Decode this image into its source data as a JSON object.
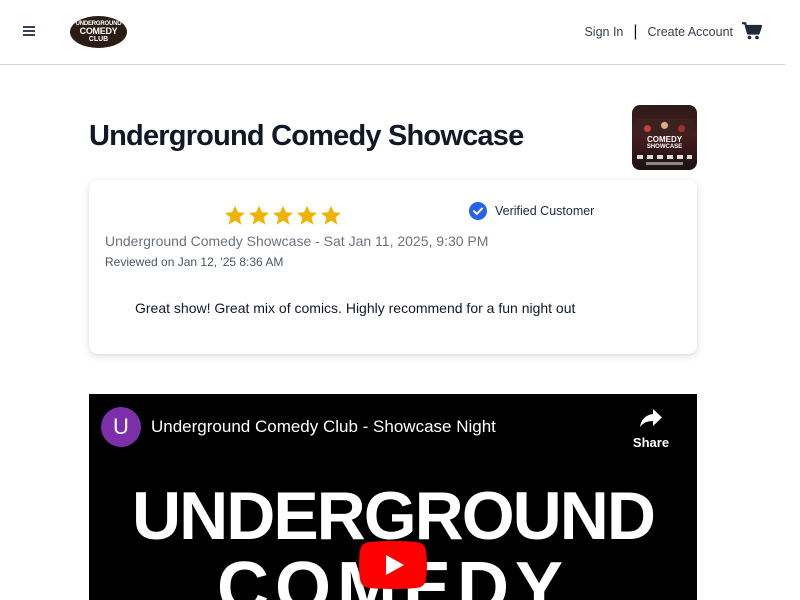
{
  "header": {
    "logo": {
      "line1": "UNDERGROUND",
      "line2": "COMEDY",
      "line3": "CLUB"
    },
    "sign_in": "Sign In",
    "separator": "|",
    "create_account": "Create Account"
  },
  "event": {
    "title": "Underground Comedy Showcase",
    "thumbnail": {
      "line1": "COMEDY",
      "line2": "SHOWCASE"
    }
  },
  "review": {
    "rating": 5,
    "max_rating": 5,
    "verified_label": "Verified Customer",
    "event_line": "Underground Comedy Showcase - Sat Jan 11, 2025, 9:30 PM",
    "reviewed_on": "Reviewed on Jan 12, '25 8:36 AM",
    "text": "Great show! Great mix of comics. Highly recommend for a fun night out"
  },
  "video": {
    "channel_initial": "U",
    "title": "Underground Comedy Club - Showcase Night",
    "share_label": "Share",
    "frame_line1": "UNDERGROUND",
    "frame_line2": "COMEDY"
  },
  "colors": {
    "star": "#f0b400",
    "verified": "#2563eb",
    "avatar": "#7b2fa8",
    "play": "#ff0000"
  },
  "icons": [
    "menu-icon",
    "cart-icon",
    "star-icon",
    "check-circle-icon",
    "share-icon",
    "play-icon"
  ]
}
